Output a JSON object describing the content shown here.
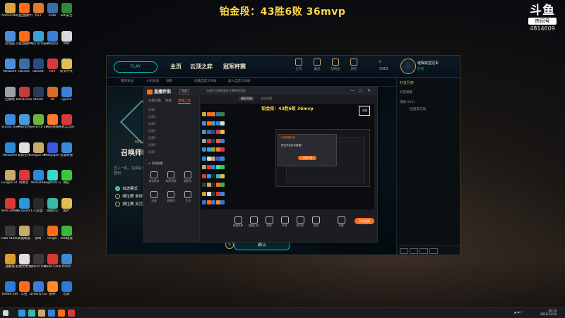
{
  "overlay": {
    "stream_title": "铂金段：43胜6败 36mvp",
    "room_logo": "斗鱼",
    "room_label": "房间号",
    "room_id": "4814609"
  },
  "desktop_icons": [
    {
      "label": "Administr...",
      "color": "#d9a441"
    },
    {
      "label": "斗鱼直播伴侣",
      "color": "#ff6d1b"
    },
    {
      "label": "PS3",
      "color": "#e07a2a"
    },
    {
      "label": "Auto",
      "color": "#3a6ea5"
    },
    {
      "label": "360安全",
      "color": "#2f8a3a"
    },
    {
      "label": "此电脑",
      "color": "#4a8fd8"
    },
    {
      "label": "斗鱼直播伴侣",
      "color": "#ff6d1b"
    },
    {
      "label": "Poly Bridge 2",
      "color": "#3aa0d8"
    },
    {
      "label": "腾讯QQ",
      "color": "#3a7fd8"
    },
    {
      "label": "MW",
      "color": "#d8d8d8"
    },
    {
      "label": "Network",
      "color": "#4a8fd8"
    },
    {
      "label": "Ubisoft",
      "color": "#3a6ea5"
    },
    {
      "label": "Ubisoft",
      "color": "#2a4b80"
    },
    {
      "label": "Aim",
      "color": "#d83a3a"
    },
    {
      "label": "新文件夹",
      "color": "#e0c050"
    },
    {
      "label": "回收站",
      "color": "#9aa0a6"
    },
    {
      "label": "Bandicam",
      "color": "#c83a3a"
    },
    {
      "label": "Steam",
      "color": "#2a3a5a"
    },
    {
      "label": "2K",
      "color": "#d86a2a"
    },
    {
      "label": "Typora",
      "color": "#3a7fd8"
    },
    {
      "label": "Studio One",
      "color": "#3a8ad8"
    },
    {
      "label": "腾讯文档",
      "color": "#4a9ad8"
    },
    {
      "label": "GeForce Experience",
      "color": "#6ab83a"
    },
    {
      "label": "腾讯视频",
      "color": "#ff7a2a"
    },
    {
      "label": "网易云音乐",
      "color": "#d83a3a"
    },
    {
      "label": "WeGame",
      "color": "#2a8ad8"
    },
    {
      "label": "新建文件",
      "color": "#e0e0e0"
    },
    {
      "label": "League of Legends",
      "color": "#c8aa6e"
    },
    {
      "label": "Wallpaper Engine",
      "color": "#3a5ad8"
    },
    {
      "label": "百度网盘",
      "color": "#3a8ad8"
    },
    {
      "label": "League of Legends",
      "color": "#c8aa6e"
    },
    {
      "label": "网易云",
      "color": "#d83a3a"
    },
    {
      "label": "WeGame",
      "color": "#2a8ad8"
    },
    {
      "label": "Logitech G HUB",
      "color": "#3ad8c8"
    },
    {
      "label": "微信",
      "color": "#3ac83a"
    },
    {
      "label": "WPS Office",
      "color": "#d83a3a"
    },
    {
      "label": "Microsoft Edge",
      "color": "#2a9ad8"
    },
    {
      "label": "小黑盒",
      "color": "#2a2a2a"
    },
    {
      "label": "网易UU",
      "color": "#3ab8a8"
    },
    {
      "label": "图片",
      "color": "#e0c050"
    },
    {
      "label": "OBS Studio",
      "color": "#3a3a3a"
    },
    {
      "label": "英雄联盟",
      "color": "#c8aa6e"
    },
    {
      "label": "剪映",
      "color": "#2a2a2a"
    },
    {
      "label": "Origin",
      "color": "#ff6d1b"
    },
    {
      "label": "360极速",
      "color": "#3ab83a"
    },
    {
      "label": "道聚城",
      "color": "#d8a02a"
    },
    {
      "label": "新建文本文档",
      "color": "#e0e0e0"
    },
    {
      "label": "Grand Theft",
      "color": "#3a3a3a"
    },
    {
      "label": "Dead Cells",
      "color": "#d83a3a"
    },
    {
      "label": "Prism",
      "color": "#3a8ad8"
    },
    {
      "label": "Battle.net",
      "color": "#2a7ad8"
    },
    {
      "label": "斗鱼",
      "color": "#ff6d1b"
    },
    {
      "label": "Draw & Guess",
      "color": "#3a7ad8"
    },
    {
      "label": "雷神",
      "color": "#ff8a2a"
    },
    {
      "label": "迅游",
      "color": "#2a7ad8"
    }
  ],
  "lol": {
    "play_button": "PLAY",
    "nav": [
      "主页",
      "云顶之弈",
      "冠军杯赛"
    ],
    "sub_nav": [
      "我的对战",
      "人机对战",
      "训练",
      "创建自定义对局",
      "加入自定义对局"
    ],
    "right_icons": [
      "主页",
      "藏品",
      "战利品",
      "商店"
    ],
    "currency_rp": "0",
    "currency_be": "5963",
    "summoner_name": "璀璨殿堂冠军",
    "summoner_status": "在线",
    "mode_tag": "5V5",
    "mode_title": "召唤师峡谷",
    "mode_desc": "五人一队，在峡谷手作战争胜利",
    "queues": [
      "自选模式",
      "排位赛 单排",
      "排位赛 灵活"
    ],
    "confirm_button": "确认",
    "friends_header": "好友列表",
    "friends_section": "好友观察",
    "friends_group": "常规 (0/1)",
    "friend_entry": "一些朋友在线"
  },
  "douyu_app": {
    "app_name": "直播伴侣",
    "tag": "免费",
    "notice": "注册后可获得更多主播特权奖励",
    "window_controls": [
      "—",
      "□",
      "✕"
    ],
    "tabs": [
      "场景切换",
      "视频",
      "直播工具"
    ],
    "scenes": [
      "场景1",
      "场景2",
      "场景3",
      "场景4",
      "场景5",
      "场景6",
      "场景7"
    ],
    "add_scene": "+ 添加场景",
    "tools": [
      "添加素材",
      "美颜滤镜",
      "摄像头",
      "连麦",
      "直播间",
      "互动"
    ],
    "preview_tabs": [
      "横屏直播",
      "竖屏直播"
    ],
    "preview_title": "铂金段：43胜6败 36mvp",
    "dialog_title": "斗鱼直播伴侣",
    "dialog_msg": "是否开启自动直播?",
    "dialog_button": "立即开启",
    "controls": [
      "直播录像",
      "直播工具",
      "美颜",
      "声音",
      "麦克风",
      "录屏",
      "设置"
    ],
    "start_live": "开始直播"
  },
  "taskbar": {
    "clock_time": "20:10",
    "clock_date": "2022/12/29"
  }
}
